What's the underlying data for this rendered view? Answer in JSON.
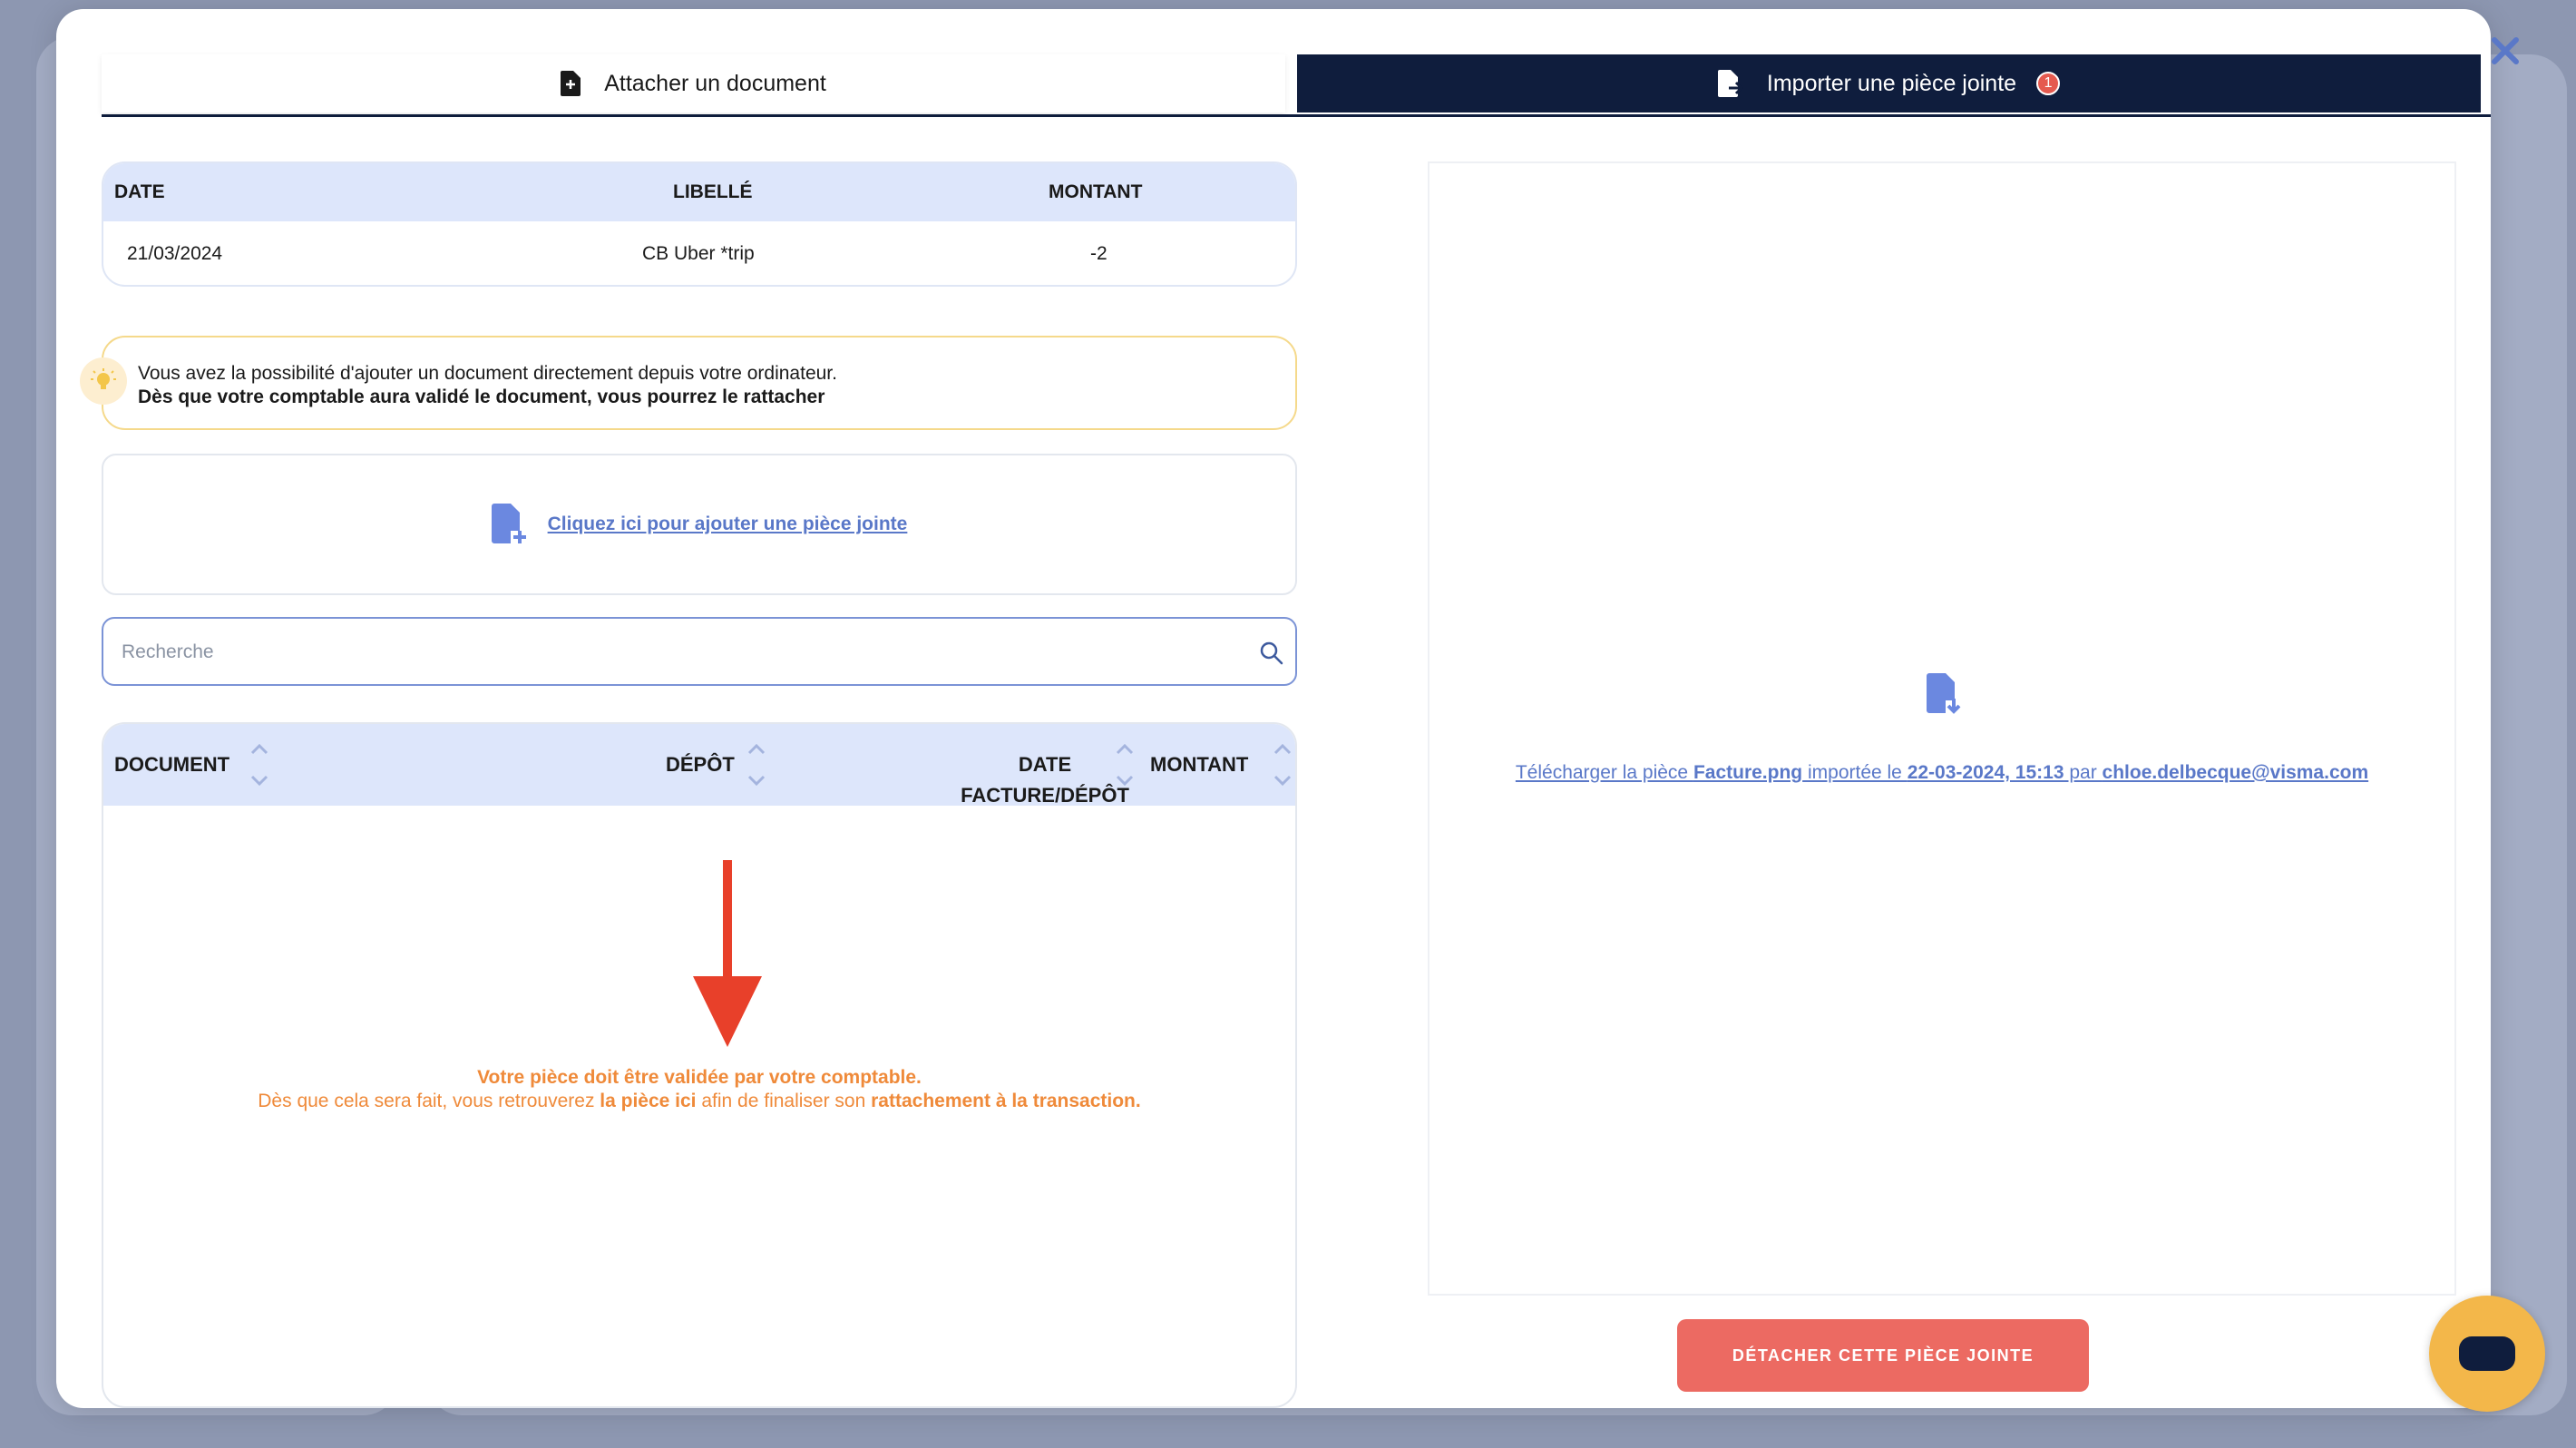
{
  "tabs": {
    "attach_label": "Attacher un document",
    "import_label": "Importer une pièce jointe",
    "import_badge": "1"
  },
  "transaction": {
    "headers": {
      "date": "DATE",
      "label": "LIBELLÉ",
      "amount": "MONTANT"
    },
    "row": {
      "date": "21/03/2024",
      "label": "CB Uber *trip",
      "amount": "-2"
    }
  },
  "hint": {
    "line1": "Vous avez la possibilité d'ajouter un document directement depuis votre ordinateur.",
    "line2": "Dès que votre comptable aura validé le document, vous pourrez le rattacher"
  },
  "upload": {
    "link_label": "Cliquez ici pour ajouter une pièce jointe"
  },
  "search": {
    "placeholder": "Recherche"
  },
  "documents": {
    "headers": {
      "document": "DOCUMENT",
      "depot": "DÉPÔT",
      "date_line1": "DATE",
      "date_line2": "FACTURE/DÉPÔT",
      "amount": "MONTANT"
    },
    "empty_message": {
      "line1": "Votre pièce doit être validée par votre comptable.",
      "line2_a": "Dès que cela sera fait, vous retrouverez ",
      "line2_b": "la pièce ici",
      "line2_c": " afin de finaliser son ",
      "line2_d": "rattachement à la transaction."
    }
  },
  "preview": {
    "dl_a": "Télécharger la pièce ",
    "dl_file": "Facture.png",
    "dl_b": " importée le ",
    "dl_date": "22-03-2024, 15:13",
    "dl_c": " par ",
    "dl_user": "chloe.delbecque@visma.com"
  },
  "actions": {
    "detach_label": "DÉTACHER CETTE PIÈCE JOINTE"
  },
  "colors": {
    "navy": "#0f1d3d",
    "accent_blue": "#5a78c8",
    "orange": "#ef8a3a",
    "red_button": "#ec6a62",
    "chat_yellow": "#f3b74a"
  },
  "icons": [
    "close-icon",
    "document-attach-icon",
    "document-import-icon",
    "lightbulb-icon",
    "file-add-icon",
    "search-icon",
    "sort-icon",
    "arrow-down-icon",
    "file-download-icon",
    "chat-icon"
  ]
}
